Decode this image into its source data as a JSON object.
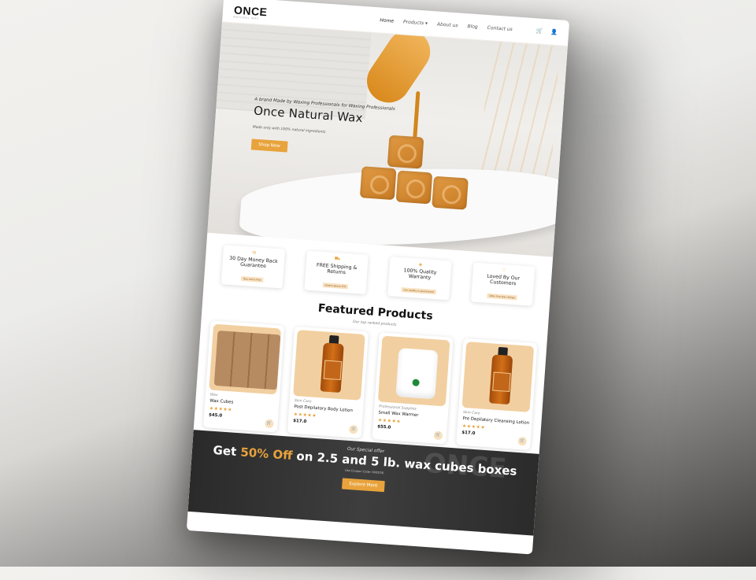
{
  "nav": {
    "logo": "ONCE",
    "logo_sub": "NATURAL WAX",
    "items": [
      "Home",
      "Products ▾",
      "About us",
      "Blog",
      "Contact us"
    ]
  },
  "hero": {
    "pre": "A brand Made by Waxing Professionals for Waxing Professionals",
    "title": "Once Natural Wax",
    "sub": "Made only with 100% natural ingredients",
    "button": "Shop Now"
  },
  "features": [
    {
      "title": "30 Day Money Back Guarantee",
      "tag": "Buy worry free"
    },
    {
      "title": "FREE Shipping & Returns",
      "tag": "Orders above $70"
    },
    {
      "title": "100% Quality Warranty",
      "tag": "Our quality is guaranteed"
    },
    {
      "title": "Loved By Our Customers",
      "tag": "100+ five star ratings"
    }
  ],
  "featured": {
    "title": "Featured Products",
    "sub": "Our top ranked products"
  },
  "products": [
    {
      "category": "Wax",
      "name": "Wax Cubes",
      "stars": "★★★★★",
      "price": "$45.0"
    },
    {
      "category": "Skin Care",
      "name": "Post Depilatory Body Lotion",
      "stars": "★★★★★",
      "price": "$17.0"
    },
    {
      "category": "Professional Supplies",
      "name": "Small Wax Warmer",
      "stars": "★★★★★",
      "price": "$55.0"
    },
    {
      "category": "Skin Care",
      "name": "Pre Depilatory Cleansing Lotion",
      "stars": "★★★★★",
      "price": "$17.0"
    }
  ],
  "promo": {
    "pre": "Our Special offer",
    "title_a": "Get ",
    "title_hl": "50% Off",
    "title_b": " on 2.5 and 5 lb. wax cubes boxes",
    "code": "Use Coupon Code: ONCE50",
    "button": "Explore More",
    "bg_text": "ONCE"
  },
  "colors": {
    "accent": "#e8a33c",
    "dark": "#2a2a2a"
  }
}
